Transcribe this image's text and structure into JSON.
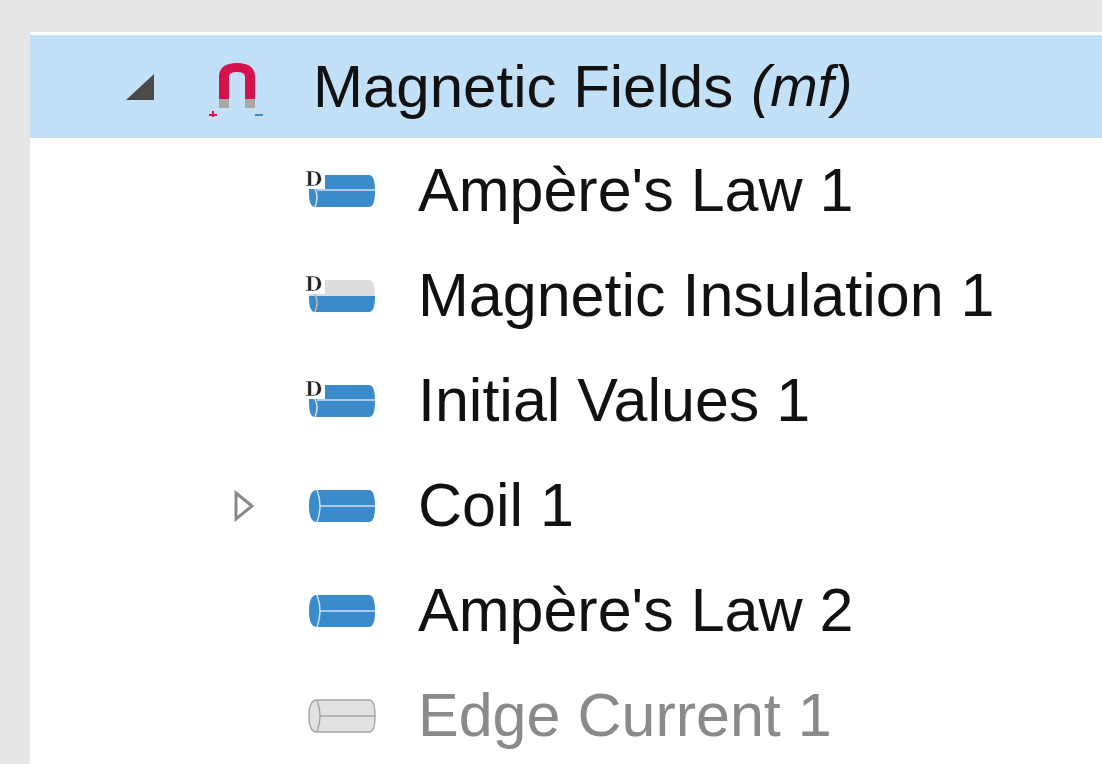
{
  "tree": {
    "label": "Magnetic Fields",
    "tag": "(mf)",
    "selected": true,
    "expanded": true,
    "children": [
      {
        "label": "Ampère's Law 1",
        "kind": "default",
        "badge": "D",
        "disabled": false
      },
      {
        "label": "Magnetic Insulation 1",
        "kind": "overridden",
        "badge": "D",
        "disabled": false
      },
      {
        "label": "Initial Values 1",
        "kind": "default",
        "badge": "D",
        "disabled": false
      },
      {
        "label": "Coil 1",
        "kind": "feature",
        "disabled": false,
        "expanded": false
      },
      {
        "label": "Ampère's Law 2",
        "kind": "feature",
        "disabled": false
      },
      {
        "label": "Edge Current 1",
        "kind": "feature",
        "disabled": true
      }
    ]
  }
}
